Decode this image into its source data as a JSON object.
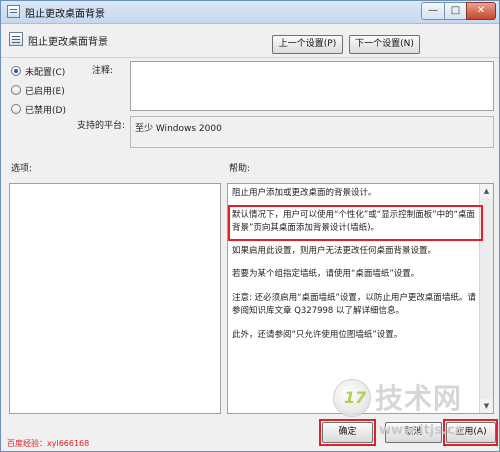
{
  "window": {
    "title": "阻止更改桌面背景",
    "controls": {
      "minimize": "—",
      "maximize": "□",
      "close": "✕"
    }
  },
  "header": {
    "title": "阻止更改桌面背景",
    "prev_label": "上一个设置(P)",
    "next_label": "下一个设置(N)"
  },
  "state_options": [
    {
      "label": "未配置(C)",
      "checked": true
    },
    {
      "label": "已启用(E)",
      "checked": false
    },
    {
      "label": "已禁用(D)",
      "checked": false
    }
  ],
  "comment": {
    "label": "注释:",
    "value": ""
  },
  "platform": {
    "label": "支持的平台:",
    "value": "至少 Windows 2000"
  },
  "options": {
    "label": "选项:"
  },
  "help": {
    "label": "帮助:",
    "paragraphs": [
      "阻止用户添加或更改桌面的背景设计。",
      "默认情况下，用户可以使用“个性化”或“显示控制面板”中的“桌面背景”页向其桌面添加背景设计(墙纸)。",
      "如果启用此设置，则用户无法更改任何桌面背景设置。",
      "若要为某个组指定墙纸，请使用“桌面墙纸”设置。",
      "注意: 还必须启用“桌面墙纸”设置，以防止用户更改桌面墙纸。请参阅知识库文章 Q327998 以了解详细信息。",
      "此外，还请参阅“只允许使用位图墙纸”设置。"
    ]
  },
  "buttons": {
    "ok": "确定",
    "cancel": "取消",
    "apply": "应用(A)"
  },
  "watermarks": {
    "left": "百度经验：xyl666168",
    "logo_number": "17",
    "logo_text": "技术网",
    "url": "www.itjs.cn"
  },
  "colors": {
    "highlight": "#e0202a",
    "radio_dot": "#2a5fb0"
  }
}
